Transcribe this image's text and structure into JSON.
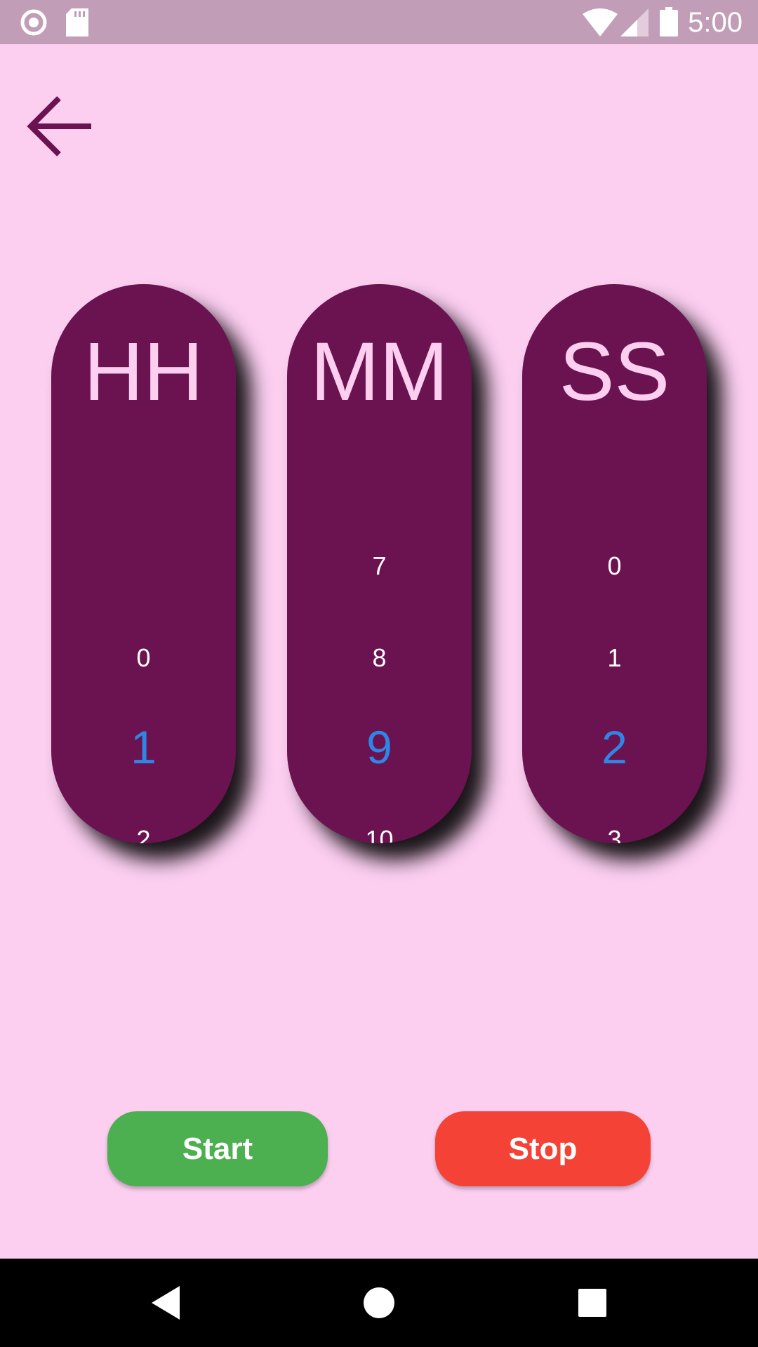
{
  "status_bar": {
    "time": "5:00",
    "icons": [
      "record-icon",
      "sd-card-icon",
      "wifi-icon",
      "signal-icon",
      "battery-icon"
    ]
  },
  "toolbar": {
    "back_icon": "arrow-back-icon"
  },
  "colors": {
    "background": "#fccff1",
    "wheel": "#6b1350",
    "selected_number": "#2e86e6",
    "start": "#4caf50",
    "stop": "#f44336"
  },
  "pickers": {
    "hours": {
      "title": "HH",
      "prev": "",
      "above": "0",
      "selected": "1",
      "below": "2"
    },
    "minutes": {
      "title": "MM",
      "prev": "7",
      "above": "8",
      "selected": "9",
      "below": "10"
    },
    "seconds": {
      "title": "SS",
      "prev": "0",
      "above": "1",
      "selected": "2",
      "below": "3"
    }
  },
  "buttons": {
    "start_label": "Start",
    "stop_label": "Stop"
  },
  "nav_bar": {
    "icons": [
      "nav-back-icon",
      "nav-home-icon",
      "nav-recents-icon"
    ]
  }
}
